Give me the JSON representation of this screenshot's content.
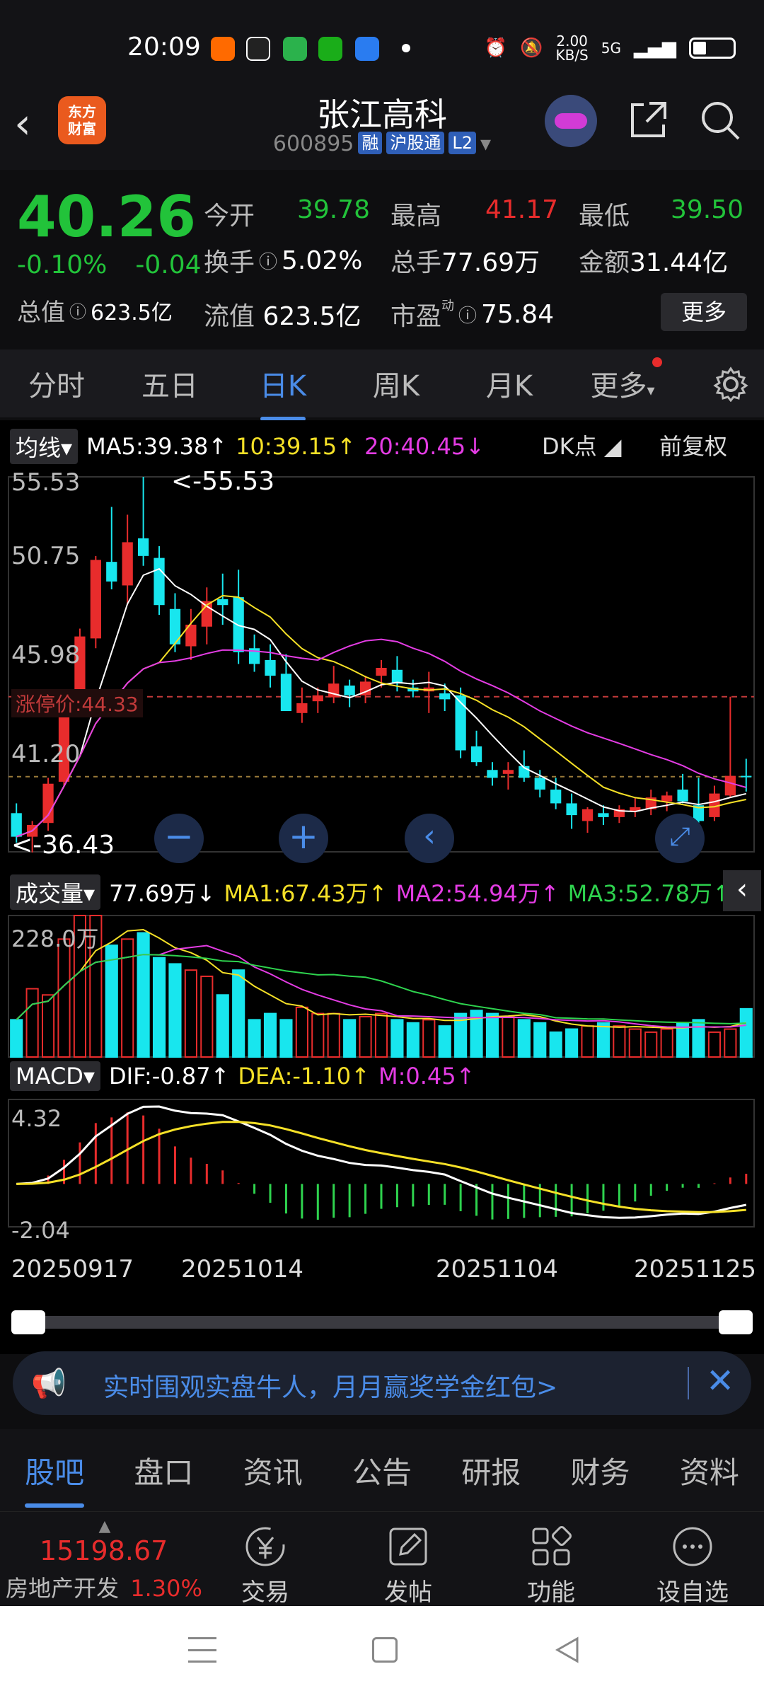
{
  "status": {
    "time": "20:09",
    "net_speed": "2.00",
    "net_unit": "KB/S",
    "net_type": "5G"
  },
  "header": {
    "back_icon": "chevron-left-icon",
    "logo_line1": "东方",
    "logo_line2": "财富",
    "stock_name": "张江高科",
    "stock_code": "600895",
    "tags": [
      "融",
      "沪股通",
      "L2"
    ]
  },
  "quote": {
    "price": "40.26",
    "change_pct": "-0.10%",
    "change_abs": "-0.04",
    "open_label": "今开",
    "open": "39.78",
    "high_label": "最高",
    "high": "41.17",
    "low_label": "最低",
    "low": "39.50",
    "turnover_label": "换手",
    "turnover": "5.02%",
    "volume_label": "总手",
    "volume": "77.69万",
    "amount_label": "金额",
    "amount": "31.44亿",
    "total_cap_label": "总值",
    "total_cap": "623.5亿",
    "float_cap_label": "流值",
    "float_cap": "623.5亿",
    "pe_label": "市盈",
    "pe_sup": "动",
    "pe": "75.84",
    "more_label": "更多"
  },
  "period_tabs": [
    "分时",
    "五日",
    "日K",
    "周K",
    "月K",
    "更多"
  ],
  "active_period": "日K",
  "chart": {
    "ma_selector": "均线",
    "ma5": "MA5:39.38",
    "ma10": "10:39.15",
    "ma20": "20:40.45",
    "dk_label": "DK点",
    "adjust_label": "前复权",
    "price_high_label": "55.53",
    "price_mid1_label": "50.75",
    "price_mid2_label": "45.98",
    "limit_label": "涨停价:44.33",
    "price_mid3_label": "41.20",
    "price_low_label": "36.43",
    "max_marker": "<-55.53",
    "min_marker": "<-36.43",
    "vol_selector": "成交量",
    "vol_value": "77.69万",
    "vol_ma1": "MA1:67.43万",
    "vol_ma2": "MA2:54.94万",
    "vol_ma3": "MA3:52.78万",
    "vol_max_label": "228.0万",
    "macd_selector": "MACD",
    "dif": "DIF:-0.87",
    "dea": "DEA:-1.10",
    "macd_m": "M:0.45",
    "macd_high_label": "4.32",
    "macd_low_label": "-2.04",
    "dates": [
      "20250917",
      "20251014",
      "20251104",
      "20251125"
    ]
  },
  "chart_data": {
    "type": "candlestick",
    "ylim": [
      36.43,
      55.53
    ],
    "candles": [
      [
        38.4,
        38.9,
        36.9,
        37.2
      ],
      [
        37.2,
        38.0,
        36.4,
        37.8
      ],
      [
        37.9,
        40.2,
        37.5,
        39.9
      ],
      [
        40.0,
        44.2,
        39.8,
        44.2
      ],
      [
        44.3,
        47.8,
        44.0,
        47.4
      ],
      [
        47.3,
        51.5,
        46.8,
        51.3
      ],
      [
        51.2,
        54.0,
        49.8,
        50.2
      ],
      [
        50.0,
        53.6,
        49.0,
        52.2
      ],
      [
        52.4,
        55.53,
        51.0,
        51.5
      ],
      [
        51.4,
        52.0,
        48.5,
        49.0
      ],
      [
        48.8,
        49.6,
        46.6,
        47.0
      ],
      [
        46.9,
        48.8,
        46.2,
        48.0
      ],
      [
        47.9,
        49.9,
        47.0,
        49.2
      ],
      [
        49.3,
        50.6,
        48.0,
        49.0
      ],
      [
        49.4,
        50.8,
        46.0,
        46.6
      ],
      [
        46.8,
        47.5,
        45.6,
        46.0
      ],
      [
        46.2,
        47.0,
        44.8,
        45.4
      ],
      [
        45.5,
        46.5,
        43.6,
        43.6
      ],
      [
        43.5,
        44.8,
        43.0,
        44.0
      ],
      [
        44.1,
        44.8,
        43.5,
        44.4
      ],
      [
        44.3,
        45.9,
        44.0,
        45.0
      ],
      [
        44.9,
        45.2,
        43.8,
        44.4
      ],
      [
        44.4,
        45.4,
        44.0,
        45.1
      ],
      [
        45.4,
        46.2,
        44.8,
        45.8
      ],
      [
        45.7,
        46.4,
        44.6,
        45.0
      ],
      [
        44.8,
        45.2,
        44.3,
        44.6
      ],
      [
        44.6,
        45.6,
        43.5,
        44.8
      ],
      [
        44.5,
        45.0,
        43.6,
        44.2
      ],
      [
        44.4,
        44.8,
        41.2,
        41.6
      ],
      [
        41.8,
        42.6,
        40.8,
        41.0
      ],
      [
        40.6,
        41.0,
        39.8,
        40.2
      ],
      [
        40.4,
        41.0,
        39.6,
        40.6
      ],
      [
        40.8,
        41.6,
        40.0,
        40.2
      ],
      [
        40.2,
        40.6,
        39.2,
        39.6
      ],
      [
        39.6,
        40.2,
        38.6,
        38.9
      ],
      [
        38.9,
        39.4,
        37.6,
        38.3
      ],
      [
        38.0,
        38.7,
        37.4,
        38.6
      ],
      [
        38.4,
        38.8,
        37.8,
        38.2
      ],
      [
        38.2,
        38.8,
        37.9,
        38.6
      ],
      [
        38.5,
        39.2,
        38.2,
        38.7
      ],
      [
        38.6,
        39.6,
        38.3,
        39.2
      ],
      [
        39.0,
        39.5,
        38.5,
        39.3
      ],
      [
        39.6,
        40.4,
        38.9,
        39.0
      ],
      [
        38.8,
        40.2,
        37.8,
        38.0
      ],
      [
        38.2,
        39.8,
        38.0,
        39.4
      ],
      [
        39.3,
        44.33,
        39.2,
        40.3
      ],
      [
        40.3,
        41.17,
        39.5,
        40.26
      ]
    ],
    "volume_ylim": [
      0,
      228.0
    ],
    "volumes": [
      60,
      110,
      100,
      190,
      228,
      228,
      180,
      190,
      200,
      160,
      150,
      140,
      130,
      100,
      140,
      60,
      70,
      60,
      80,
      70,
      70,
      60,
      65,
      70,
      60,
      55,
      60,
      50,
      70,
      75,
      70,
      65,
      60,
      55,
      40,
      45,
      50,
      55,
      50,
      45,
      40,
      45,
      55,
      60,
      40,
      45,
      77.69
    ],
    "macd_ylim": [
      -2.04,
      4.32
    ]
  },
  "banner": {
    "text": "实时围观实盘牛人，月月赢奖学金红包>"
  },
  "bottom_tabs": [
    "股吧",
    "盘口",
    "资讯",
    "公告",
    "研报",
    "财务",
    "资料"
  ],
  "active_bottom_tab": "股吧",
  "index": {
    "value": "15198.67",
    "name": "房地产开发",
    "pct": "1.30%"
  },
  "actions": [
    "交易",
    "发帖",
    "功能",
    "设自选"
  ]
}
